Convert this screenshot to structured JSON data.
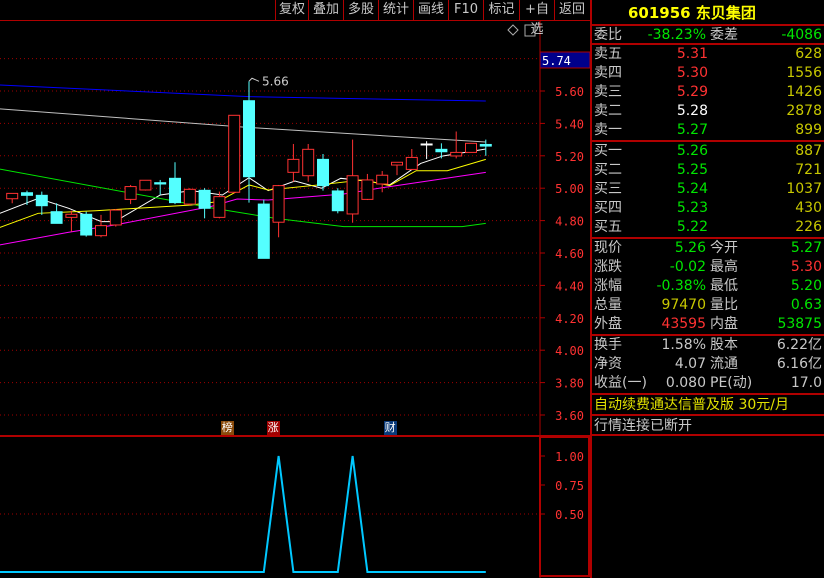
{
  "toolbar": {
    "buttons": [
      "复权",
      "叠加",
      "多股",
      "统计",
      "画线",
      "F10",
      "标记",
      "+自选",
      "返回"
    ]
  },
  "chart_data": [
    {
      "type": "candlestick",
      "y_ticks": [
        "5.60",
        "5.40",
        "5.20",
        "5.00",
        "4.80",
        "4.60",
        "4.40",
        "4.20",
        "4.00",
        "3.80",
        "3.60"
      ],
      "ylim": [
        3.5,
        5.85
      ],
      "current_price_tag": "5.74",
      "high_annotation": "5.66",
      "up_color": "#ff3232",
      "down_color": "#54ffff",
      "grid": "dotted",
      "candles": [
        [
          4.935,
          4.968,
          4.907,
          4.968
        ],
        [
          4.972,
          4.985,
          4.896,
          4.956
        ],
        [
          4.956,
          4.979,
          4.835,
          4.892
        ],
        [
          4.855,
          4.907,
          4.783,
          4.783
        ],
        [
          4.82,
          4.861,
          4.732,
          4.839
        ],
        [
          4.839,
          4.855,
          4.701,
          4.711
        ],
        [
          4.707,
          4.835,
          4.697,
          4.769
        ],
        [
          4.773,
          4.872,
          4.763,
          4.865
        ],
        [
          4.931,
          5.02,
          4.902,
          5.01
        ],
        [
          4.989,
          5.05,
          4.985,
          5.049
        ],
        [
          5.034,
          5.051,
          4.958,
          5.026
        ],
        [
          5.061,
          5.16,
          4.902,
          4.911
        ],
        [
          4.902,
          5.0,
          4.896,
          4.993
        ],
        [
          4.987,
          5.0,
          4.814,
          4.876
        ],
        [
          4.82,
          4.979,
          4.814,
          4.948
        ],
        [
          4.975,
          5.45,
          4.968,
          5.45
        ],
        [
          5.54,
          5.66,
          4.911,
          5.071
        ],
        [
          4.902,
          4.93,
          4.567,
          4.567
        ],
        [
          4.79,
          5.02,
          4.697,
          5.016
        ],
        [
          5.098,
          5.273,
          5.04,
          5.178
        ],
        [
          5.077,
          5.273,
          5.04,
          5.24
        ],
        [
          5.178,
          5.211,
          4.985,
          5.016
        ],
        [
          4.983,
          5.0,
          4.845,
          4.861
        ],
        [
          4.841,
          5.3,
          4.787,
          5.077
        ],
        [
          4.931,
          5.088,
          4.927,
          5.051
        ],
        [
          5.026,
          5.106,
          4.975,
          5.08
        ],
        [
          5.143,
          5.16,
          5.081,
          5.16
        ],
        [
          5.116,
          5.242,
          5.112,
          5.19
        ],
        [
          5.273,
          5.29,
          5.18,
          5.273
        ],
        [
          5.24,
          5.277,
          5.184,
          5.225
        ],
        [
          5.199,
          5.35,
          5.184,
          5.221
        ],
        [
          5.221,
          5.28,
          5.22,
          5.277
        ],
        [
          5.27,
          5.3,
          5.2,
          5.26
        ]
      ],
      "ma_lines": [
        {
          "color": "#ffffff",
          "points": [
            [
              -0.83,
              4.845
            ],
            [
              1.76,
              4.937
            ],
            [
              3.82,
              4.876
            ],
            [
              6.02,
              4.794
            ],
            [
              6.93,
              4.794
            ],
            [
              10,
              4.958
            ],
            [
              12.1,
              4.985
            ],
            [
              14.2,
              4.958
            ],
            [
              16,
              5.065
            ],
            [
              17.3,
              4.985
            ],
            [
              19.1,
              5.044
            ],
            [
              20.9,
              5.0
            ],
            [
              22.2,
              5.061
            ],
            [
              24,
              5.044
            ],
            [
              25.5,
              5.02
            ],
            [
              27.6,
              5.153
            ],
            [
              29.1,
              5.199
            ],
            [
              32,
              5.242
            ]
          ]
        },
        {
          "color": "#ffff00",
          "points": [
            [
              -0.83,
              4.758
            ],
            [
              1.76,
              4.845
            ],
            [
              5.63,
              4.861
            ],
            [
              12.1,
              4.896
            ],
            [
              13.9,
              4.917
            ],
            [
              16,
              5.02
            ],
            [
              17.3,
              4.989
            ],
            [
              21.1,
              5.024
            ],
            [
              23.7,
              5.051
            ],
            [
              25.5,
              5.016
            ],
            [
              27.3,
              5.108
            ],
            [
              29.4,
              5.108
            ],
            [
              32,
              5.178
            ]
          ]
        },
        {
          "color": "#ff00ff",
          "points": [
            [
              -0.83,
              4.65
            ],
            [
              3.82,
              4.728
            ],
            [
              6.93,
              4.773
            ],
            [
              13.4,
              4.886
            ],
            [
              15.2,
              4.933
            ],
            [
              17.3,
              4.927
            ],
            [
              22.4,
              4.964
            ],
            [
              25,
              5.003
            ],
            [
              32,
              5.098
            ]
          ]
        },
        {
          "color": "#00e600",
          "points": [
            [
              -0.83,
              5.118
            ],
            [
              13.6,
              4.876
            ],
            [
              17.8,
              4.814
            ],
            [
              22.4,
              4.763
            ],
            [
              30.4,
              4.763
            ],
            [
              32,
              4.783
            ]
          ]
        },
        {
          "color": "#c0c0c0",
          "points": [
            [
              -0.83,
              5.49
            ],
            [
              16,
              5.375
            ],
            [
              32,
              5.285
            ]
          ]
        },
        {
          "color": "#0000ff",
          "points": [
            [
              -0.83,
              5.637
            ],
            [
              16,
              5.565
            ],
            [
              32,
              5.538
            ]
          ]
        }
      ],
      "markers": [
        {
          "label": "榜",
          "candle": 14.5,
          "color": "#8a4a0a"
        },
        {
          "label": "涨",
          "candle": 17.6,
          "color": "#a00000"
        },
        {
          "label": "财",
          "candle": 25.5,
          "color": "#0a3a7a"
        }
      ]
    },
    {
      "type": "line",
      "y_ticks": [
        "1.00",
        "0.75",
        "0.50"
      ],
      "ylim": [
        0,
        1
      ],
      "color": "#00c8ff",
      "values": [
        0,
        0,
        0,
        0,
        0,
        0,
        0,
        0,
        0,
        0,
        0,
        0,
        0,
        0,
        0,
        0,
        0,
        0,
        1,
        0,
        0,
        0,
        0,
        1,
        0,
        0,
        0,
        0,
        0,
        0,
        0,
        0,
        0
      ]
    }
  ],
  "panel": {
    "code": "601956",
    "name": "东贝集团",
    "wb": {
      "label": "委比",
      "value": "-38.23%",
      "label2": "委差",
      "value2": "-4086"
    },
    "sell": [
      {
        "label": "卖五",
        "price": "5.31",
        "vol": "628",
        "c": "r"
      },
      {
        "label": "卖四",
        "price": "5.30",
        "vol": "1556",
        "c": "r"
      },
      {
        "label": "卖三",
        "price": "5.29",
        "vol": "1426",
        "c": "r"
      },
      {
        "label": "卖二",
        "price": "5.28",
        "vol": "2878",
        "c": "w"
      },
      {
        "label": "卖一",
        "price": "5.27",
        "vol": "899",
        "c": "g"
      }
    ],
    "buy": [
      {
        "label": "买一",
        "price": "5.26",
        "vol": "887",
        "c": "g"
      },
      {
        "label": "买二",
        "price": "5.25",
        "vol": "721",
        "c": "g"
      },
      {
        "label": "买三",
        "price": "5.24",
        "vol": "1037",
        "c": "g"
      },
      {
        "label": "买四",
        "price": "5.23",
        "vol": "430",
        "c": "g"
      },
      {
        "label": "买五",
        "price": "5.22",
        "vol": "226",
        "c": "g"
      }
    ],
    "quote": [
      {
        "l1": "现价",
        "v1": "5.26",
        "c1": "g",
        "l2": "今开",
        "v2": "5.27",
        "c2": "g"
      },
      {
        "l1": "涨跌",
        "v1": "-0.02",
        "c1": "g",
        "l2": "最高",
        "v2": "5.30",
        "c2": "r"
      },
      {
        "l1": "涨幅",
        "v1": "-0.38%",
        "c1": "g",
        "l2": "最低",
        "v2": "5.20",
        "c2": "g"
      },
      {
        "l1": "总量",
        "v1": "97470",
        "c1": "y",
        "l2": "量比",
        "v2": "0.63",
        "c2": "g"
      },
      {
        "l1": "外盘",
        "v1": "43595",
        "c1": "r",
        "l2": "内盘",
        "v2": "53875",
        "c2": "g"
      }
    ],
    "fin": [
      {
        "l1": "换手",
        "v1": "1.58%",
        "l2": "股本",
        "v2": "6.22亿"
      },
      {
        "l1": "净资",
        "v1": "4.07",
        "l2": "流通",
        "v2": "6.16亿"
      },
      {
        "l1": "收益(一)",
        "v1": "0.080",
        "l2": "PE(动)",
        "v2": "17.0"
      }
    ],
    "ad": "自动续费通达信普及版  30元/月",
    "status": "行情连接已断开"
  }
}
